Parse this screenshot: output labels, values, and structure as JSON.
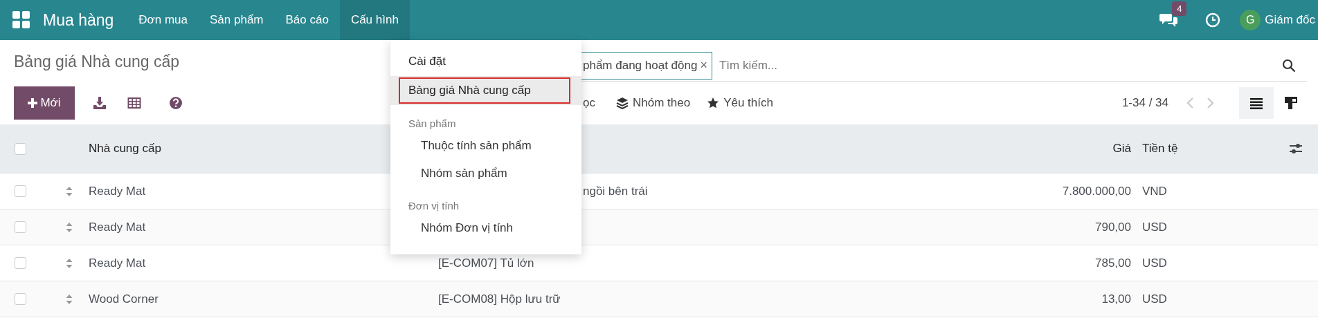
{
  "navbar": {
    "app_title": "Mua hàng",
    "menu": [
      {
        "label": "Đơn mua",
        "selected": false
      },
      {
        "label": "Sản phẩm",
        "selected": false
      },
      {
        "label": "Báo cáo",
        "selected": false
      },
      {
        "label": "Cấu hình",
        "selected": true
      }
    ],
    "message_count": "4",
    "user_initial": "G",
    "user_name": "Giám đốc"
  },
  "dropdown": {
    "items": [
      {
        "kind": "item",
        "label": "Cài đặt",
        "selected": false
      },
      {
        "kind": "item",
        "label": "Bảng giá Nhà cung cấp",
        "selected": true
      },
      {
        "kind": "header",
        "label": "Sản phẩm"
      },
      {
        "kind": "subitem",
        "label": "Thuộc tính sản phẩm"
      },
      {
        "kind": "subitem",
        "label": "Nhóm sản phẩm"
      },
      {
        "kind": "header",
        "label": "Đơn vị tính"
      },
      {
        "kind": "subitem",
        "label": "Nhóm Đơn vị tính"
      }
    ]
  },
  "breadcrumb": "Bảng giá Nhà cung cấp",
  "new_button": "Mới",
  "search": {
    "facet": "phẩm đang hoạt động",
    "facet_remove": "×",
    "placeholder": "Tìm kiếm..."
  },
  "filter_tail": "ọc",
  "group_by": "Nhóm theo",
  "favorites": "Yêu thích",
  "pager": "1-34 / 34",
  "views": [
    {
      "kind": "list",
      "selected": true
    },
    {
      "kind": "kanban",
      "selected": false
    }
  ],
  "table": {
    "columns": [
      "Nhà cung cấp",
      "Giá",
      "Tiền tệ"
    ],
    "all_checked": false,
    "rows": [
      {
        "checked": false,
        "supplier": "Ready Mat",
        "product": "ngồi bên trái",
        "product_cut": true,
        "price": "7.800.000,00",
        "currency": "VND"
      },
      {
        "checked": false,
        "supplier": "Ready Mat",
        "price": "790,00",
        "currency": "USD"
      },
      {
        "checked": false,
        "supplier": "Ready Mat",
        "product": "[E-COM07] Tủ lớn",
        "price": "785,00",
        "currency": "USD"
      },
      {
        "checked": false,
        "supplier": "Wood Corner",
        "product": "[E-COM08] Hộp lưu trữ",
        "price": "13,00",
        "currency": "USD"
      }
    ]
  }
}
